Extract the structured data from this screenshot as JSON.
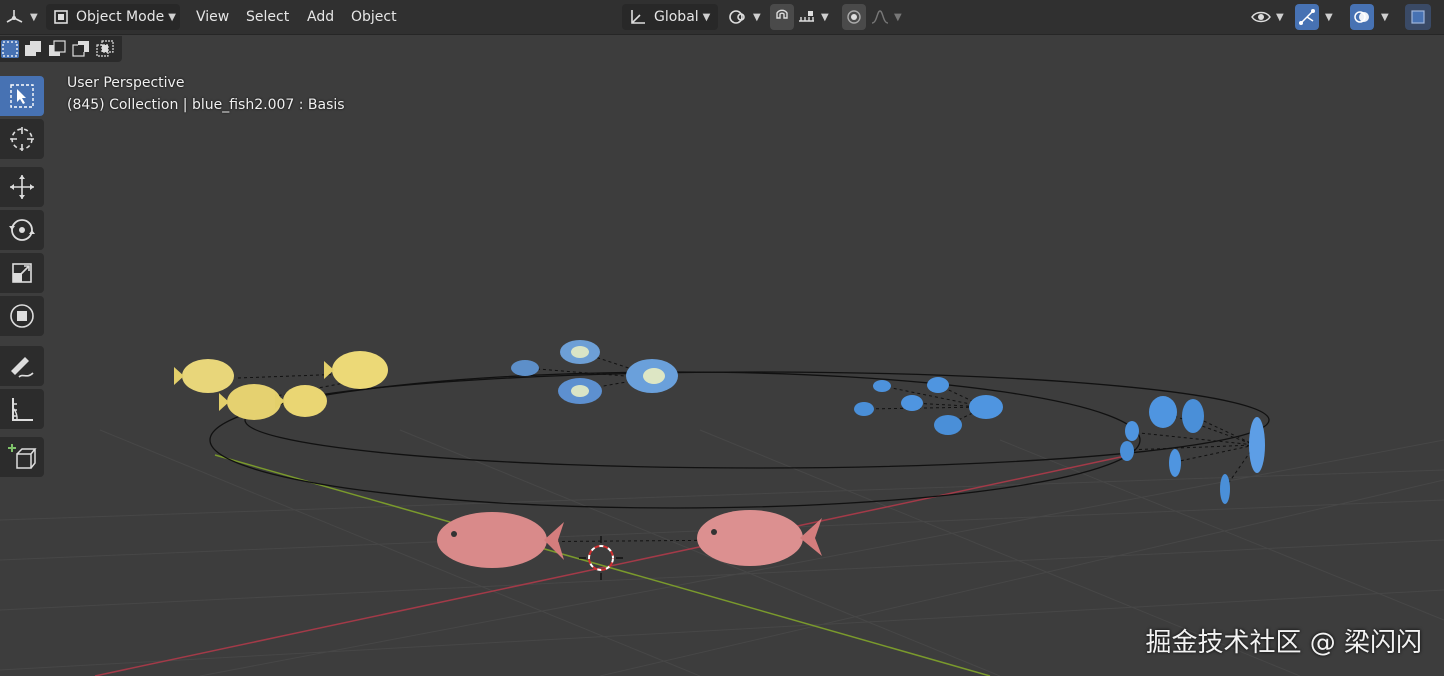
{
  "header": {
    "editor_type_icon": "editor-type-icon",
    "mode_label": "Object Mode",
    "menus": [
      "View",
      "Select",
      "Add",
      "Object"
    ],
    "transform_orientation": "Global",
    "pivot_icon": "pivot-point-icon",
    "snap_icon": "snap-magnet-icon",
    "snap_target_icon": "snap-increment-icon",
    "proportional_icon": "proportional-edit-icon",
    "falloff_icon": "falloff-curve-icon",
    "visibility_icon": "eye-icon",
    "gizmo_icon": "gizmo-icon",
    "overlay_icon": "overlay-icon",
    "xray_icon": "xray-icon"
  },
  "selection_modes": [
    "select-new-icon",
    "select-extend-icon",
    "select-subtract-icon",
    "select-invert-icon",
    "select-intersect-icon"
  ],
  "tools": [
    {
      "name": "select-box-tool",
      "icon": "cursor-arrow-icon",
      "active": true
    },
    {
      "name": "cursor-tool",
      "icon": "3d-cursor-icon",
      "active": false
    },
    {
      "name": "move-tool",
      "icon": "move-arrows-icon",
      "active": false
    },
    {
      "name": "rotate-tool",
      "icon": "rotate-icon",
      "active": false
    },
    {
      "name": "scale-tool",
      "icon": "scale-icon",
      "active": false
    },
    {
      "name": "transform-tool",
      "icon": "transform-icon",
      "active": false
    },
    {
      "name": "annotate-tool",
      "icon": "annotate-pen-icon",
      "active": false
    },
    {
      "name": "measure-tool",
      "icon": "measure-ruler-icon",
      "active": false
    },
    {
      "name": "add-cube-tool",
      "icon": "add-cube-icon",
      "active": false
    }
  ],
  "viewport": {
    "view_name": "User Perspective",
    "info_line": "(845) Collection | blue_fish2.007 : Basis"
  },
  "watermark": "掘金技术社区 @ 梁闪闪",
  "colors": {
    "background": "#3d3d3d",
    "header": "#303030",
    "accent": "#4772b3",
    "x_axis": "#a33a48",
    "y_axis": "#7a9a2c",
    "yellow_fish": "#e8d67a",
    "blue_fish": "#4a8fd8",
    "red_fish": "#d98a8a"
  }
}
